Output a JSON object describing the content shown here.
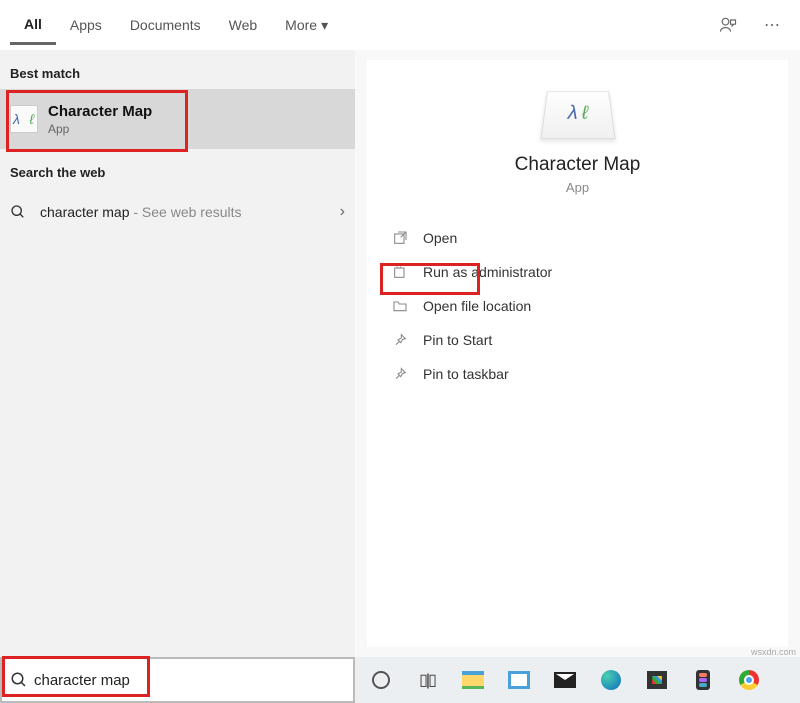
{
  "tabs": {
    "all": "All",
    "apps": "Apps",
    "documents": "Documents",
    "web": "Web",
    "more": "More"
  },
  "left": {
    "best_match_header": "Best match",
    "best_match": {
      "title": "Character Map",
      "subtitle": "App"
    },
    "search_web_header": "Search the web",
    "web_result": {
      "query": "character map",
      "suffix": " - See web results"
    }
  },
  "right": {
    "app_title": "Character Map",
    "app_subtitle": "App",
    "actions": {
      "open": "Open",
      "run_admin": "Run as administrator",
      "open_loc": "Open file location",
      "pin_start": "Pin to Start",
      "pin_taskbar": "Pin to taskbar"
    }
  },
  "search": {
    "value": "character map"
  },
  "watermark": "wsxdn.com"
}
